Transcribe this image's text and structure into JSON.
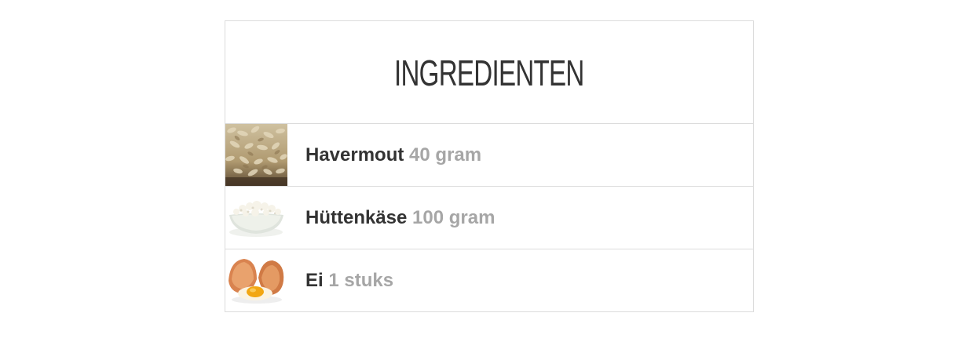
{
  "title": "INGREDIENTEN",
  "ingredients": [
    {
      "name": "Havermout",
      "amount": "40 gram",
      "image": "oats-image"
    },
    {
      "name": "Hüttenkäse",
      "amount": "100 gram",
      "image": "cottage-cheese-image"
    },
    {
      "name": "Ei",
      "amount": "1 stuks",
      "image": "egg-image"
    }
  ],
  "colors": {
    "name_text": "#333333",
    "amount_text": "#a6a6a6",
    "border": "#dcdcdc"
  }
}
